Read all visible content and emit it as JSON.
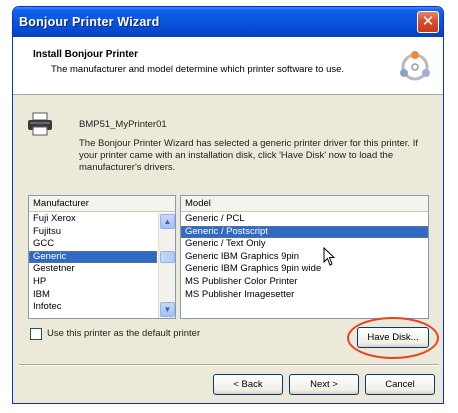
{
  "window": {
    "title": "Bonjour Printer Wizard",
    "close_glyph": "✕"
  },
  "header": {
    "title": "Install Bonjour Printer",
    "subtitle": "The manufacturer and model determine which printer software to use.",
    "logo_icon": "bonjour-logo-icon"
  },
  "printer": {
    "name": "BMP51_MyPrinter01",
    "description": "The Bonjour Printer Wizard has selected a generic printer driver for this printer.  If your printer came with an installation disk, click 'Have Disk' now to load the manufacturer's drivers."
  },
  "manufacturer_list": {
    "header": "Manufacturer",
    "items": [
      "Fuji Xerox",
      "Fujitsu",
      "GCC",
      "Generic",
      "Gestetner",
      "HP",
      "IBM",
      "Infotec"
    ],
    "selected_index": 3,
    "scroll_up": "▲",
    "scroll_down": "▼"
  },
  "model_list": {
    "header": "Model",
    "items": [
      "Generic / PCL",
      "Generic / Postscript",
      "Generic / Text Only",
      "Generic IBM Graphics 9pin",
      "Generic IBM Graphics 9pin wide",
      "MS Publisher Color Printer",
      "MS Publisher Imagesetter"
    ],
    "selected_index": 1
  },
  "default_checkbox": {
    "label": "Use this printer as the default printer",
    "checked": false
  },
  "buttons": {
    "have_disk": "Have Disk...",
    "back": "< Back",
    "next": "Next >",
    "cancel": "Cancel"
  },
  "colors": {
    "title_bar": "#0a55de",
    "selection": "#316ac5",
    "highlight_ring": "#e8421e"
  }
}
